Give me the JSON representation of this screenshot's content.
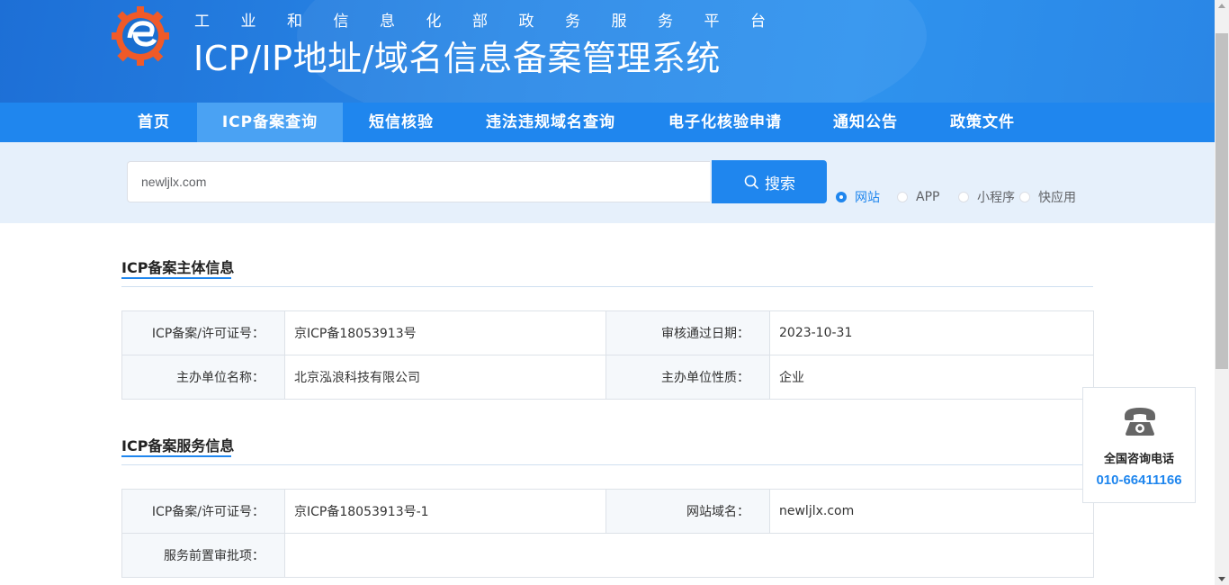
{
  "header": {
    "subtitle": "工业和信息化部政务服务平台",
    "title": "ICP/IP地址/域名信息备案管理系统"
  },
  "nav": {
    "items": [
      {
        "label": "首页"
      },
      {
        "label": "ICP备案查询",
        "active": true
      },
      {
        "label": "短信核验"
      },
      {
        "label": "违法违规域名查询"
      },
      {
        "label": "电子化核验申请"
      },
      {
        "label": "通知公告"
      },
      {
        "label": "政策文件"
      }
    ]
  },
  "search": {
    "value": "newljlx.com",
    "button_label": "搜索",
    "options": [
      {
        "label": "网站",
        "checked": true
      },
      {
        "label": "APP"
      },
      {
        "label": "小程序"
      },
      {
        "label": "快应用"
      }
    ]
  },
  "subject": {
    "title": "ICP备案主体信息",
    "rows": [
      {
        "l1": "ICP备案/许可证号：",
        "v1": "京ICP备18053913号",
        "l2": "审核通过日期：",
        "v2": "2023-10-31"
      },
      {
        "l1": "主办单位名称：",
        "v1": "北京泓浪科技有限公司",
        "l2": "主办单位性质：",
        "v2": "企业"
      }
    ]
  },
  "service": {
    "title": "ICP备案服务信息",
    "row1": {
      "l1": "ICP备案/许可证号：",
      "v1": "京ICP备18053913号-1",
      "l2": "网站域名：",
      "v2": "newljlx.com"
    },
    "row2": {
      "l1": "服务前置审批项：",
      "v1": ""
    }
  },
  "contact": {
    "label": "全国咨询电话",
    "number": "010-66411166"
  },
  "colors": {
    "primary": "#1f86ee",
    "header_bg": "#2b8ae8",
    "search_band": "#e6f0fb",
    "logo_orange": "#f05a28"
  }
}
